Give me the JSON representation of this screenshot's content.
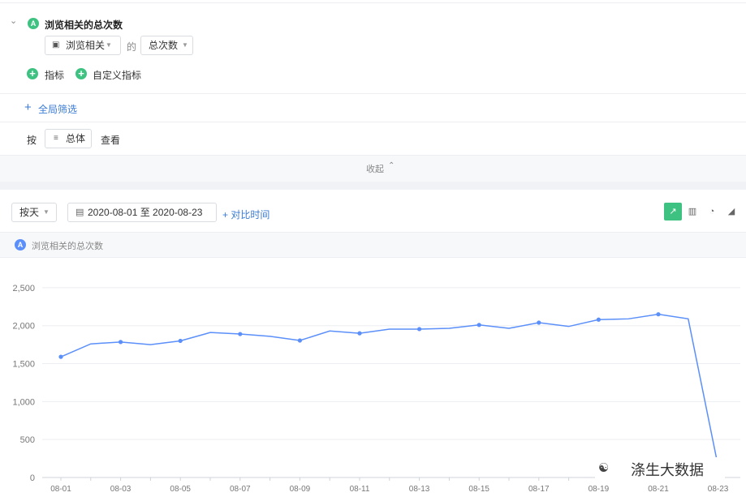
{
  "metric": {
    "badge": "A",
    "name": "浏览相关的总次数",
    "event_select": "浏览相关",
    "of_word": "的",
    "measure_select": "总次数"
  },
  "actions": {
    "add_metric": "指标",
    "add_custom_metric": "自定义指标",
    "global_filter": "全局筛选"
  },
  "group_by": {
    "prefix": "按",
    "value": "总体",
    "suffix": "查看"
  },
  "collapse_label": "收起",
  "toolbar": {
    "granularity": "按天",
    "date_range": "2020-08-01 至 2020-08-23",
    "compare": "+ 对比时间"
  },
  "legend": {
    "badge": "A",
    "label": "浏览相关的总次数"
  },
  "watermark": "涤生大数据",
  "colors": {
    "accent_green": "#3ec281",
    "line_blue": "#5b8ff9",
    "link_blue": "#3a7bd5"
  },
  "chart_data": {
    "type": "line",
    "x": [
      "08-01",
      "08-02",
      "08-03",
      "08-04",
      "08-05",
      "08-06",
      "08-07",
      "08-08",
      "08-09",
      "08-10",
      "08-11",
      "08-12",
      "08-13",
      "08-14",
      "08-15",
      "08-16",
      "08-17",
      "08-18",
      "08-19",
      "08-20",
      "08-21",
      "08-22",
      "08-23"
    ],
    "x_tick_labels": [
      "08-01",
      "08-03",
      "08-05",
      "08-07",
      "08-09",
      "08-11",
      "08-13",
      "08-15",
      "08-17",
      "08-19",
      "08-21",
      "08-23"
    ],
    "series": [
      {
        "name": "浏览相关的总次数",
        "values": [
          1590,
          1760,
          1785,
          1750,
          1800,
          1910,
          1890,
          1860,
          1805,
          1930,
          1900,
          1955,
          1955,
          1965,
          2010,
          1965,
          2040,
          1990,
          2080,
          2090,
          2150,
          2090,
          150
        ]
      }
    ],
    "y_tick_labels": [
      "0",
      "500",
      "1,000",
      "1,500",
      "2,000",
      "2,500"
    ],
    "ylim": [
      0,
      2500
    ],
    "grid": true
  }
}
